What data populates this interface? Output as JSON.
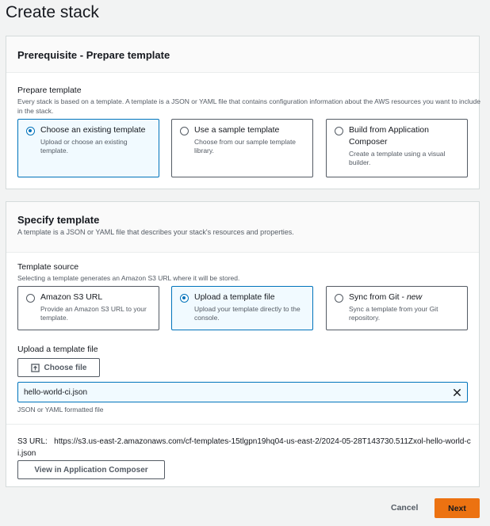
{
  "page": {
    "title": "Create stack"
  },
  "prerequisite": {
    "title": "Prerequisite - Prepare template",
    "field_label": "Prepare template",
    "field_desc": "Every stack is based on a template. A template is a JSON or YAML file that contains configuration information about the AWS resources you want to include in the stack.",
    "options": [
      {
        "title": "Choose an existing template",
        "desc": "Upload or choose an existing template.",
        "selected": true
      },
      {
        "title": "Use a sample template",
        "desc": "Choose from our sample template library.",
        "selected": false
      },
      {
        "title": "Build from Application Composer",
        "desc": "Create a template using a visual builder.",
        "selected": false
      }
    ]
  },
  "specify": {
    "title": "Specify template",
    "desc": "A template is a JSON or YAML file that describes your stack's resources and properties.",
    "source_label": "Template source",
    "source_desc": "Selecting a template generates an Amazon S3 URL where it will be stored.",
    "options": [
      {
        "title": "Amazon S3 URL",
        "desc": "Provide an Amazon S3 URL to your template.",
        "selected": false
      },
      {
        "title": "Upload a template file",
        "desc": "Upload your template directly to the console.",
        "selected": true
      },
      {
        "title": "Sync from Git - ",
        "title_em": "new",
        "desc": "Sync a template from your Git repository.",
        "selected": false
      }
    ],
    "upload_label": "Upload a template file",
    "choose_file_label": "Choose file",
    "file_name": "hello-world-ci.json",
    "file_hint": "JSON or YAML formatted file",
    "s3_url_label": "S3 URL:",
    "s3_url_value": "https://s3.us-east-2.amazonaws.com/cf-templates-15tlgpn19hq04-us-east-2/2024-05-28T143730.511Zxol-hello-world-ci.json",
    "view_composer_label": "View in Application Composer"
  },
  "footer": {
    "cancel_label": "Cancel",
    "next_label": "Next"
  },
  "colors": {
    "accent": "#0073bb",
    "primary_button": "#ec7211"
  }
}
